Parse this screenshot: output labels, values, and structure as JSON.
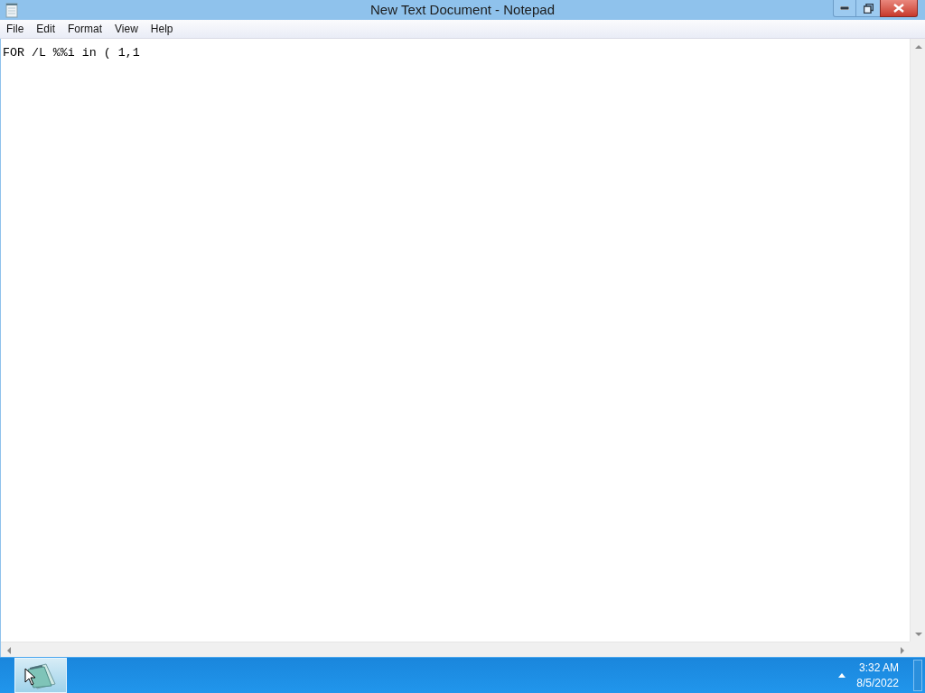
{
  "window": {
    "title": "New Text Document - Notepad"
  },
  "menu": [
    {
      "label": "File"
    },
    {
      "label": "Edit"
    },
    {
      "label": "Format"
    },
    {
      "label": "View"
    },
    {
      "label": "Help"
    }
  ],
  "editor": {
    "text": "FOR /L %%i in ( 1,1"
  },
  "taskbar": {
    "apps": [
      {
        "kind": "notepad",
        "selected": true
      }
    ],
    "clock": {
      "time": "3:32 AM",
      "date": "8/5/2022"
    }
  }
}
